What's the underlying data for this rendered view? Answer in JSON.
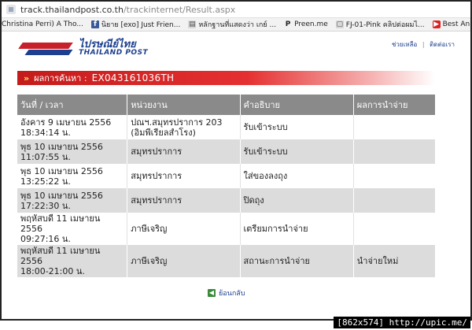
{
  "browser": {
    "url_host": "track.thailandpost.co.th",
    "url_path": "/trackinternet/Result.aspx"
  },
  "bookmarks": [
    {
      "label": "Christina Perri) A Tho...",
      "icon": "document-icon"
    },
    {
      "label": "นิยาย [exo] Just Frien...",
      "icon": "facebook-icon"
    },
    {
      "label": "หลักฐานที่แสดงว่า เกย์ ...",
      "icon": "document-icon"
    },
    {
      "label": "Preen.me",
      "icon": "preen-icon"
    },
    {
      "label": "FJ-01-Pink คลิปต่อผมไ...",
      "icon": "page-icon"
    },
    {
      "label": "Best Anime OSTs - Sis ...",
      "icon": "youtube-icon"
    }
  ],
  "site": {
    "logo_thai": "ไปรษณีย์ไทย",
    "logo_en": "THAILAND POST",
    "link_help": "ช่วยเหลือ",
    "link_sep": "|",
    "link_contact": "ติดต่อเรา"
  },
  "result": {
    "arrows": "»",
    "label": "ผลการค้นหา :",
    "code": "EX043161036TH"
  },
  "table": {
    "headers": [
      "วันที่ / เวลา",
      "หน่วยงาน",
      "คำอธิบาย",
      "ผลการนำจ่าย"
    ],
    "rows": [
      {
        "date": "อังคาร 9 เมษายน 2556",
        "time": "18:34:14 น.",
        "office": "ปณฯ.สมุทรปราการ 203",
        "office2": "(อิมพีเรียลสำโรง)",
        "desc": "รับเข้าระบบ",
        "result": ""
      },
      {
        "date": "พุธ 10 เมษายน 2556",
        "time": "11:07:55 น.",
        "office": "สมุทรปราการ",
        "office2": "",
        "desc": "รับเข้าระบบ",
        "result": ""
      },
      {
        "date": "พุธ 10 เมษายน 2556",
        "time": "13:25:22 น.",
        "office": "สมุทรปราการ",
        "office2": "",
        "desc": "ใส่ของลงถุง",
        "result": ""
      },
      {
        "date": "พุธ 10 เมษายน 2556",
        "time": "17:22:30 น.",
        "office": "สมุทรปราการ",
        "office2": "",
        "desc": "ปิดถุง",
        "result": ""
      },
      {
        "date": "พฤหัสบดี 11 เมษายน 2556",
        "time": "09:27:16 น.",
        "office": "ภาษีเจริญ",
        "office2": "",
        "desc": "เตรียมการนำจ่าย",
        "result": ""
      },
      {
        "date": "พฤหัสบดี 11 เมษายน 2556",
        "time": "18:00-21:00 น.",
        "office": "ภาษีเจริญ",
        "office2": "",
        "desc": "สถานะการนำจ่าย",
        "result": "นำจ่ายใหม่"
      }
    ]
  },
  "back_label": "ย้อนกลับ",
  "watermark": "[862x574] http://upic.me/"
}
